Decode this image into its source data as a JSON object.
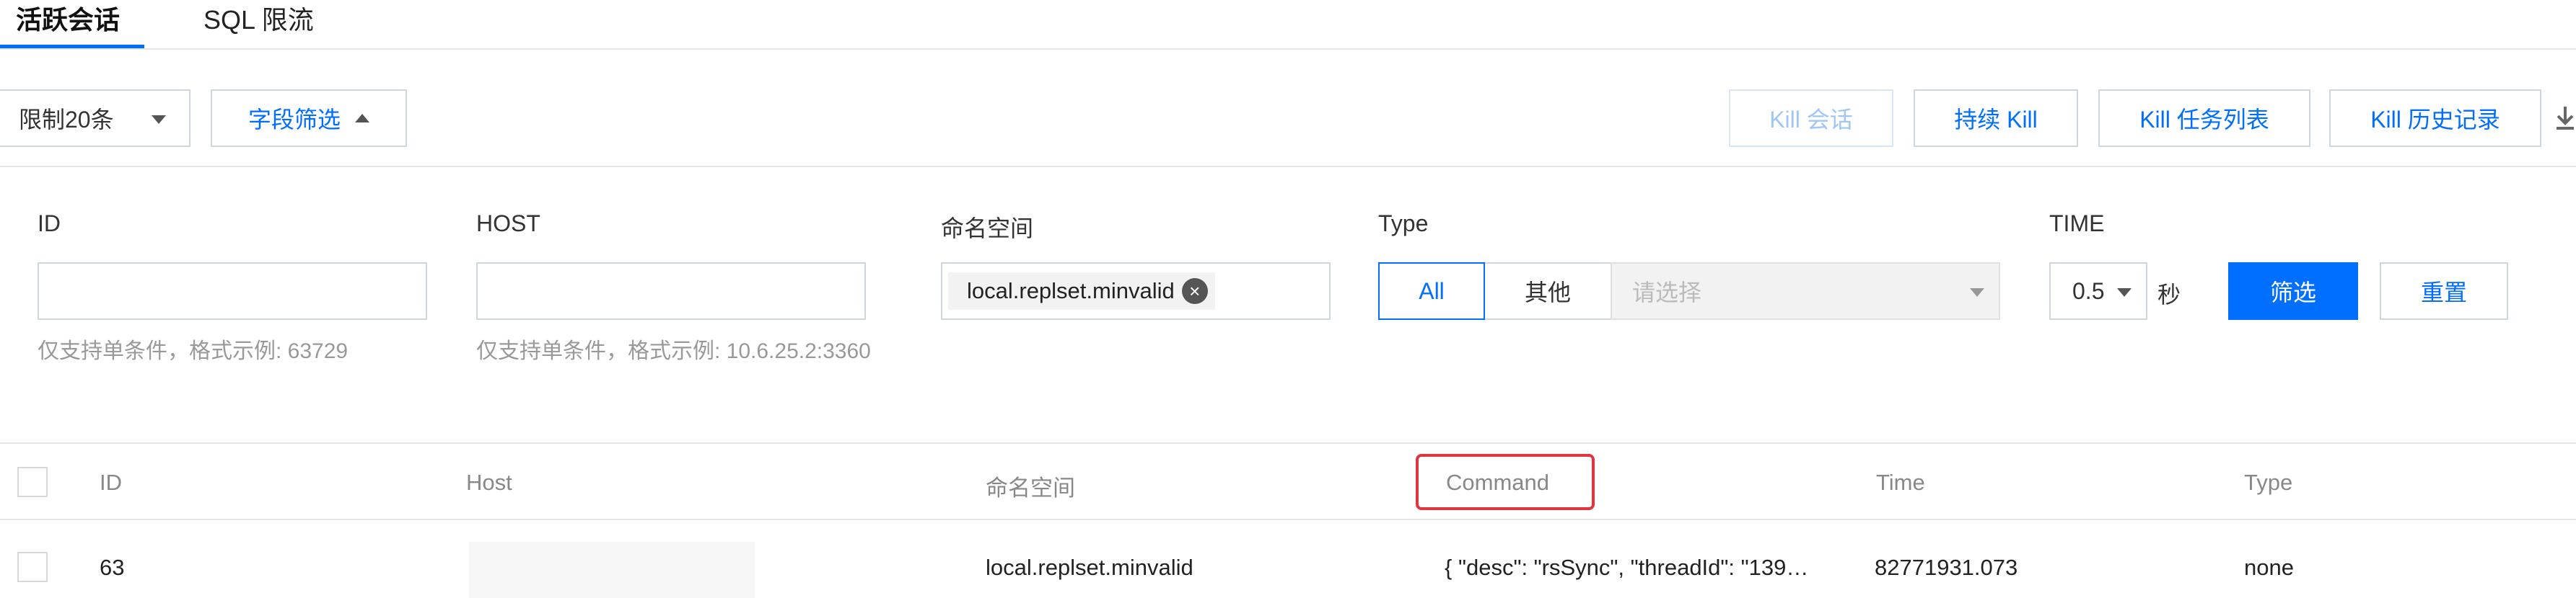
{
  "tabs": [
    {
      "label": "活跃会话",
      "active": true
    },
    {
      "label": "SQL 限流",
      "active": false
    }
  ],
  "toolbar": {
    "limit_select": "限制20条",
    "field_filter": "字段筛选",
    "kill_session": "Kill 会话",
    "continuous_kill": "持续 Kill",
    "kill_task_list": "Kill 任务列表",
    "kill_history": "Kill 历史记录"
  },
  "filter": {
    "id_label": "ID",
    "id_value": "",
    "id_hint": "仅支持单条件，格式示例: 63729",
    "host_label": "HOST",
    "host_value": "",
    "host_hint": "仅支持单条件，格式示例: 10.6.25.2:3360",
    "ns_label": "命名空间",
    "ns_tag": "local.replset.minvalid",
    "type_label": "Type",
    "type_all": "All",
    "type_other": "其他",
    "type_placeholder": "请选择",
    "time_label": "TIME",
    "time_value": "0.5",
    "time_unit": "秒",
    "filter_button": "筛选",
    "reset_button": "重置"
  },
  "table": {
    "columns": [
      "ID",
      "Host",
      "命名空间",
      "Command",
      "Time",
      "Type"
    ],
    "rows": [
      {
        "id": "63",
        "host": "",
        "namespace": "local.replset.minvalid",
        "command": "{ \"desc\": \"rsSync\", \"threadId\": \"139…",
        "time": "82771931.073",
        "type": "none"
      }
    ]
  },
  "colors": {
    "accent": "#006eff",
    "highlight": "#e0343e"
  }
}
